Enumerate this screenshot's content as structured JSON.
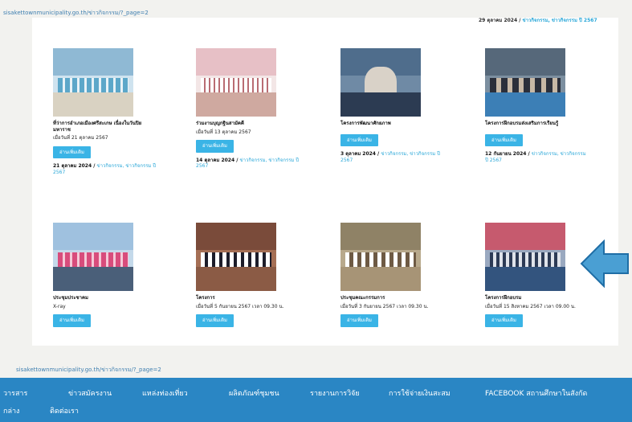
{
  "browser": {
    "top_url": "sisakettownmunicipality.go.th/ข่าวกิจกรรม/?_page=2",
    "bottom_url": "sisakettownmunicipality.go.th/ข่าวกิจกรรม/?_page=2"
  },
  "top_row": [
    {
      "meta": "",
      "category": ""
    },
    {
      "meta": "",
      "category": ""
    },
    {
      "meta": "",
      "category": ""
    },
    {
      "meta": "29 ตุลาคม 2024 /",
      "category": "ข่าวกิจกรรม, ข่าวกิจกรรม ปี 2567"
    }
  ],
  "cards_row1": [
    {
      "title": "ที่ว่าการอำเภอเมืองศรีสะเกษ เนื่องในวันปิยมหาราช",
      "excerpt": "เมื่อวันที่ 21 ตุลาคม 2567",
      "more": "อ่านเพิ่มเติม",
      "meta": "21 ตุลาคม 2024 /",
      "category": "ข่าวกิจกรรม, ข่าวกิจกรรม ปี 2567"
    },
    {
      "title": "ร่วมงานบุญกฐินสามัคคี",
      "excerpt": "เมื่อวันที่ 13 ตุลาคม 2567",
      "more": "อ่านเพิ่มเติม",
      "meta": "14 ตุลาคม 2024 /",
      "category": "ข่าวกิจกรรม, ข่าวกิจกรรม ปี 2567"
    },
    {
      "title": "โครงการพัฒนาศักยภาพ",
      "excerpt": "",
      "more": "อ่านเพิ่มเติม",
      "meta": "3 ตุลาคม 2024 /",
      "category": "ข่าวกิจกรรม, ข่าวกิจกรรม ปี 2567"
    },
    {
      "title": "โครงการฝึกอบรมส่งเสริมการเรียนรู้",
      "excerpt": "",
      "more": "อ่านเพิ่มเติม",
      "meta": "12 กันยายน 2024 /",
      "category": "ข่าวกิจกรรม, ข่าวกิจกรรม ปี 2567"
    }
  ],
  "cards_row2": [
    {
      "title": "ประชุมประชาคม",
      "excerpt": "X-ray",
      "more": "อ่านเพิ่มเติม"
    },
    {
      "title": "โครงการ",
      "excerpt": "เมื่อวันที่ 5 กันยายน 2567 เวลา 09.30 น.",
      "more": "อ่านเพิ่มเติม"
    },
    {
      "title": "ประชุมคณะกรรมการ",
      "excerpt": "เมื่อวันที่ 3 กันยายน 2567 เวลา 09.30 น.",
      "more": "อ่านเพิ่มเติม"
    },
    {
      "title": "โครงการฝึกอบรม",
      "excerpt": "เมื่อวันที่ 15 สิงหาคม 2567 เวลา 09.00 น.",
      "more": "อ่านเพิ่มเติม"
    }
  ],
  "nav": {
    "row1": [
      "วารสาร",
      "ข่าวสมัครงาน",
      "แหล่งท่องเที่ยว",
      "ผลิตภัณฑ์ชุมชน",
      "รายงานการวิจัย",
      "การใช้จ่ายเงินสะสม",
      "FACEBOOK สถานศึกษาในสังกัด"
    ],
    "row2": [
      "กล่าง",
      "ติดต่อเรา"
    ]
  },
  "colors": {
    "accent": "#3ab4e6",
    "nav": "#2a86c4",
    "arrow": "#3a93c9"
  }
}
